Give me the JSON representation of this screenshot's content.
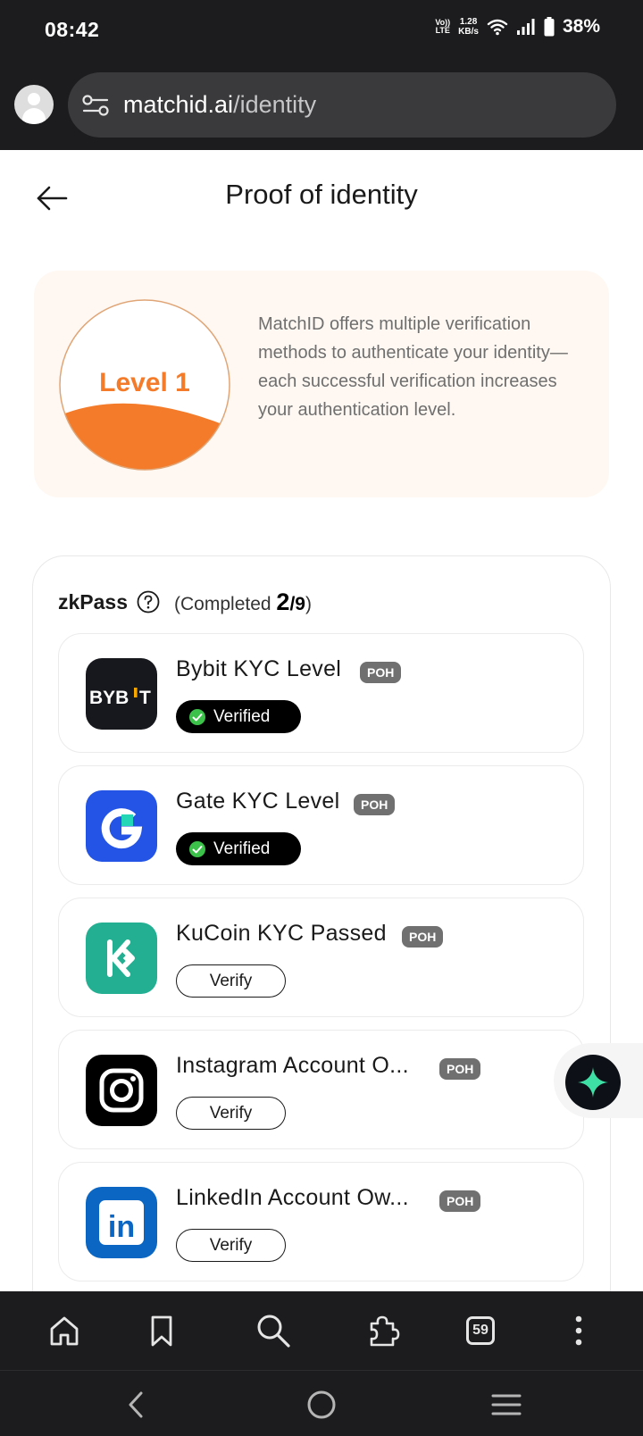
{
  "status_bar": {
    "time": "08:42",
    "volte_line1": "Vo))",
    "volte_line2": "LTE",
    "speed_value": "1.28",
    "speed_unit": "KB/s",
    "battery": "38%"
  },
  "browser": {
    "url_domain": "matchid.ai",
    "url_path": "/identity",
    "tab_count": "59"
  },
  "page": {
    "title": "Proof of identity"
  },
  "level": {
    "label": "Level 1",
    "description": "MatchID offers multiple verification methods to authenticate your identity—each successful verification increases your authentication level.",
    "accent_color": "#f47b2a"
  },
  "zkpass": {
    "title": "zkPass",
    "progress_open": "(Completed ",
    "completed": "2",
    "total": "/9",
    "progress_close": ")",
    "items": [
      {
        "name": "Bybit KYC Level",
        "tag": "POH",
        "status": "Verified",
        "logo": "bybit-logo"
      },
      {
        "name": "Gate KYC Level",
        "tag": "POH",
        "status": "Verified",
        "logo": "gate-logo"
      },
      {
        "name": "KuCoin KYC Passed",
        "tag": "POH",
        "status": "Verify",
        "logo": "kucoin-logo"
      },
      {
        "name": "Instagram Account O...",
        "tag": "POH",
        "status": "Verify",
        "logo": "instagram-logo"
      },
      {
        "name": "LinkedIn Account Ow...",
        "tag": "POH",
        "status": "Verify",
        "logo": "linkedin-logo"
      }
    ],
    "logo_texts": {
      "bybit_a": "BYB",
      "bybit_b": "T",
      "linkedin": "in"
    }
  },
  "colors": {
    "dark_bar": "#1c1c1e",
    "verified_check": "#3cc14a",
    "bybit_accent": "#f7a600",
    "gate_blue": "#2354e6",
    "kucoin_green": "#23af91",
    "linkedin_blue": "#0a66c2"
  }
}
